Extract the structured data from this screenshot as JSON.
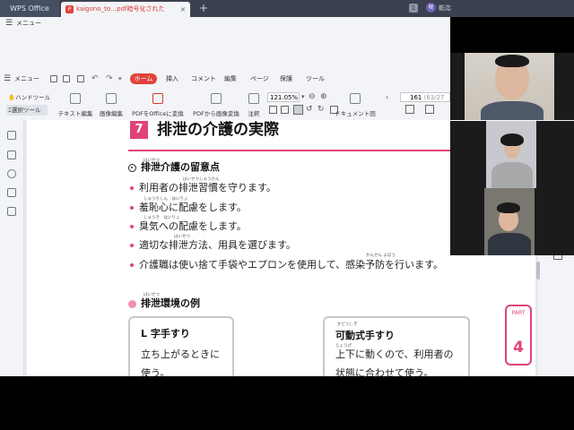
{
  "window": {
    "app_name": "WPS Office",
    "tab_title": "kaigono_to…pdf暗号化された",
    "tab_close": "×",
    "new_tab": "+",
    "box_icon": "1",
    "avatar_initial": "咲",
    "user_name": "乾迄"
  },
  "menu": {
    "menu_button": "メニュー",
    "tabs": [
      {
        "label": "ホーム",
        "active": true
      },
      {
        "label": "挿入"
      },
      {
        "label": "コメント"
      },
      {
        "label": "編集"
      },
      {
        "label": "ページ"
      },
      {
        "label": "保護"
      },
      {
        "label": "ツール"
      }
    ]
  },
  "toolbar": {
    "hand_tool": "ハンドツール",
    "select_tool": "選択ツール",
    "text_edit": "テキスト編集",
    "image_edit": "画像編集",
    "pdf_to_office": "PDFをOfficeに変換",
    "pdf_to_image": "PDFから画像変換",
    "annotate": "注釈",
    "rotate": "ドキュメント回転",
    "zoom": "121.05%",
    "page_current": "161",
    "page_total": "(63/27"
  },
  "document": {
    "section_number": "7",
    "section_title": "排泄の介護の実際",
    "sub1": {
      "ruby": "はいせつ",
      "title": "排泄介護の留意点",
      "items": [
        {
          "text": "利用者の排泄習慣を守ります。",
          "ruby": "はいせつしゅうかん"
        },
        {
          "text": "羞恥心に配慮をします。",
          "ruby": "しゅうちしん　はいりょ"
        },
        {
          "text": "臭気への配慮をします。",
          "ruby": "しゅうき　はいりょ"
        },
        {
          "text": "適切な排泄方法、用具を選びます。",
          "ruby": "はいせつ"
        },
        {
          "text": "介護職は使い捨て手袋やエプロンを使用して、感染予防を行います。",
          "ruby": "かんせん よぼう"
        }
      ]
    },
    "sub2": {
      "ruby": "はいせつ",
      "title": "排泄環境の例",
      "cards": [
        {
          "title": "L 字手すり",
          "lines": [
            "立ち上がるときに",
            "使う。"
          ]
        },
        {
          "title": "可動式手すり",
          "ruby": "かどうしき",
          "lines": [
            "上下に動くので、利用者の",
            "状態に合わせて使う。"
          ],
          "ruby2": "じょうげ"
        }
      ]
    },
    "part_label": "PART",
    "part_number": "4"
  },
  "colors": {
    "accent": "#e0437a",
    "wps_red": "#e0433a",
    "titlebar": "#3c4150"
  }
}
